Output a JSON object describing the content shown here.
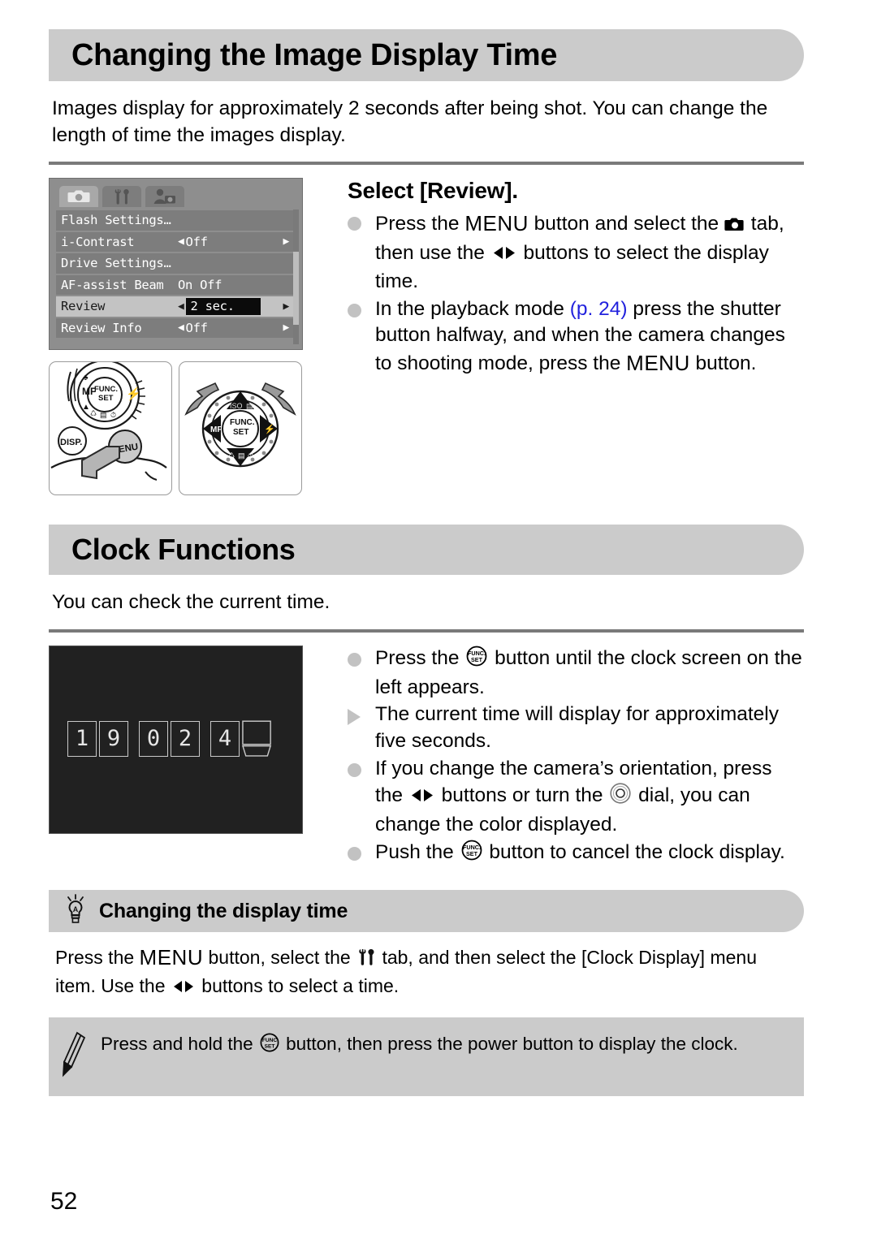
{
  "page": {
    "number": "52"
  },
  "section1": {
    "title": "Changing the Image Display Time",
    "intro": "Images display for approximately 2 seconds after being shot. You can change the length of time the images display.",
    "step_title": "Select [Review].",
    "bullets": [
      {
        "mark": "dot",
        "parts": [
          {
            "t": "text",
            "v": "Press the "
          },
          {
            "t": "menu",
            "v": "MENU"
          },
          {
            "t": "text",
            "v": " button and select the "
          },
          {
            "t": "icon",
            "v": "camera-tab-icon"
          },
          {
            "t": "text",
            "v": " tab, then use the "
          },
          {
            "t": "icon",
            "v": "left-right-buttons-icon"
          },
          {
            "t": "text",
            "v": " buttons to select the display time."
          }
        ]
      },
      {
        "mark": "dot",
        "parts": [
          {
            "t": "text",
            "v": "In the playback mode "
          },
          {
            "t": "link",
            "v": "(p. 24)"
          },
          {
            "t": "text",
            "v": " press the shutter button halfway, and when the camera changes to shooting mode, press the "
          },
          {
            "t": "menu",
            "v": "MENU"
          },
          {
            "t": "text",
            "v": " button."
          }
        ]
      }
    ],
    "lcd_menu": {
      "tabs": [
        {
          "name": "shooting-tab",
          "icon": "camera-icon",
          "active": true
        },
        {
          "name": "settings-tab",
          "icon": "tools-icon",
          "active": false
        },
        {
          "name": "my-camera-tab",
          "icon": "person-camera-icon",
          "active": false
        }
      ],
      "rows": [
        {
          "label": "Flash Settings…",
          "value": "",
          "arrows": false,
          "highlight": false,
          "boxed": false
        },
        {
          "label": "i-Contrast",
          "value": "Off",
          "arrows": true,
          "highlight": false,
          "boxed": false
        },
        {
          "label": "Drive Settings…",
          "value": "",
          "arrows": false,
          "highlight": false,
          "boxed": false
        },
        {
          "label": "AF-assist Beam",
          "value": "On Off",
          "arrows": false,
          "highlight": false,
          "boxed": false
        },
        {
          "label": "Review",
          "value": "2 sec.",
          "arrows": true,
          "highlight": true,
          "boxed": true
        },
        {
          "label": "Review Info",
          "value": "Off",
          "arrows": true,
          "highlight": false,
          "boxed": false
        }
      ]
    },
    "illustrations": [
      {
        "name": "menu-button-press-illustration",
        "caption": ""
      },
      {
        "name": "control-dial-rotate-illustration",
        "caption": ""
      }
    ]
  },
  "section2": {
    "title": "Clock Functions",
    "intro": "You can check the current time.",
    "clock_display": {
      "digits": [
        "1",
        "9",
        "0",
        "2",
        "4"
      ],
      "flipping_digit": true
    },
    "bullets": [
      {
        "mark": "dot",
        "parts": [
          {
            "t": "text",
            "v": "Press the "
          },
          {
            "t": "icon",
            "v": "func-set-button-icon"
          },
          {
            "t": "text",
            "v": " button until the clock screen on the left appears."
          }
        ]
      },
      {
        "mark": "triangle",
        "parts": [
          {
            "t": "text",
            "v": "The current time will display for approximately five seconds."
          }
        ]
      },
      {
        "mark": "dot",
        "parts": [
          {
            "t": "text",
            "v": "If you change the camera’s orientation, press the "
          },
          {
            "t": "icon",
            "v": "left-right-buttons-icon"
          },
          {
            "t": "text",
            "v": " buttons or turn the "
          },
          {
            "t": "icon",
            "v": "control-dial-icon"
          },
          {
            "t": "text",
            "v": " dial, you can change the color displayed."
          }
        ]
      },
      {
        "mark": "dot",
        "parts": [
          {
            "t": "text",
            "v": "Push the "
          },
          {
            "t": "icon",
            "v": "func-set-button-icon"
          },
          {
            "t": "text",
            "v": " button to cancel the clock display."
          }
        ]
      }
    ],
    "tip": {
      "icon": "lightbulb-icon",
      "title": "Changing the display time",
      "body_parts": [
        {
          "t": "text",
          "v": "Press the "
        },
        {
          "t": "menu",
          "v": "MENU"
        },
        {
          "t": "text",
          "v": " button, select the "
        },
        {
          "t": "icon",
          "v": "tools-icon"
        },
        {
          "t": "text",
          "v": " tab, and then select the [Clock Display] menu item. Use the "
        },
        {
          "t": "icon",
          "v": "left-right-buttons-icon"
        },
        {
          "t": "text",
          "v": " buttons to select a time."
        }
      ]
    },
    "note": {
      "icon": "pencil-icon",
      "body_parts": [
        {
          "t": "text",
          "v": "Press and hold the "
        },
        {
          "t": "icon",
          "v": "func-set-button-icon"
        },
        {
          "t": "text",
          "v": " button, then press the power button to display the clock."
        }
      ]
    }
  },
  "colors": {
    "bar_gray": "#cbcbcb",
    "rule_gray": "#7a7a7a",
    "bullet_gray": "#c2c2c2",
    "link_blue": "#2222dd",
    "lcd_bg": "#8e8e8e",
    "lcd_row": "#7d7d7d",
    "clock_bg": "#212121"
  }
}
